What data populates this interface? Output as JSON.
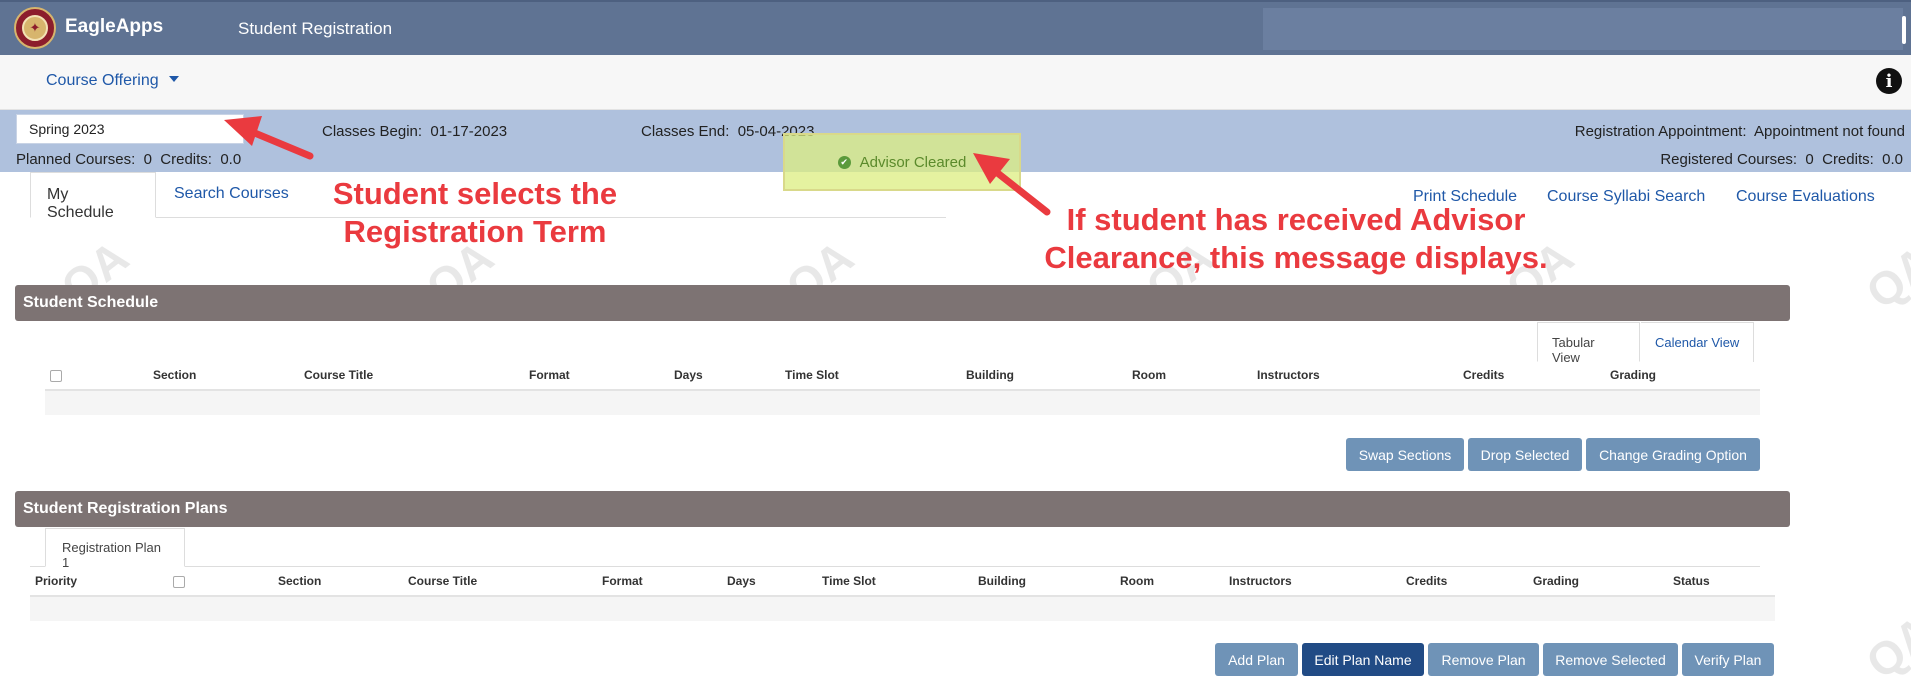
{
  "header": {
    "brand": "EagleApps",
    "app_title": "Student Registration"
  },
  "nav": {
    "dropdown_label": "Course Offering"
  },
  "term_bar": {
    "selected_term": "Spring 2023",
    "classes_begin_label": "Classes Begin:",
    "classes_begin": "01-17-2023",
    "classes_end_label": "Classes End:",
    "classes_end": "05-04-2023",
    "planned_courses_label": "Planned Courses:",
    "planned_courses": "0",
    "planned_credits_label": "Credits:",
    "planned_credits": "0.0",
    "registration_appointment_label": "Registration Appointment:",
    "registration_appointment": "Appointment not found",
    "registered_courses_label": "Registered Courses:",
    "registered_courses": "0",
    "registered_credits_label": "Credits:",
    "registered_credits": "0.0",
    "advisor_status": "Advisor Cleared"
  },
  "tabs": {
    "my_schedule": "My Schedule",
    "search_courses": "Search Courses"
  },
  "links": {
    "print_schedule": "Print Schedule",
    "course_syllabi_search": "Course Syllabi Search",
    "course_evaluations": "Course Evaluations"
  },
  "annotations": {
    "term_line1": "Student selects the",
    "term_line2": "Registration Term",
    "advisor_line1": "If student has received Advisor",
    "advisor_line2": "Clearance, this message displays."
  },
  "watermark": "QA",
  "schedule": {
    "title": "Student Schedule",
    "view_tabular": "Tabular View",
    "view_calendar": "Calendar View",
    "columns": [
      "Section",
      "Course Title",
      "Format",
      "Days",
      "Time Slot",
      "Building",
      "Room",
      "Instructors",
      "Credits",
      "Grading"
    ],
    "buttons": {
      "swap": "Swap Sections",
      "drop": "Drop Selected",
      "grading": "Change Grading Option"
    }
  },
  "plans": {
    "title": "Student Registration Plans",
    "plan_tab": "Registration Plan 1",
    "columns": [
      "Priority",
      "Section",
      "Course Title",
      "Format",
      "Days",
      "Time Slot",
      "Building",
      "Room",
      "Instructors",
      "Credits",
      "Grading",
      "Status"
    ],
    "buttons": {
      "add": "Add Plan",
      "edit": "Edit Plan Name",
      "remove": "Remove Plan",
      "remove_selected": "Remove Selected",
      "verify": "Verify Plan"
    }
  },
  "colors": {
    "header_bg": "#5f7393",
    "term_bar_bg": "#afc1dd",
    "panel_header_bg": "#7d7373",
    "button_bg": "#6f93b7",
    "button_dark_bg": "#214b85",
    "annotation_red": "#ea3a3f",
    "link_blue": "#1f58a8"
  }
}
